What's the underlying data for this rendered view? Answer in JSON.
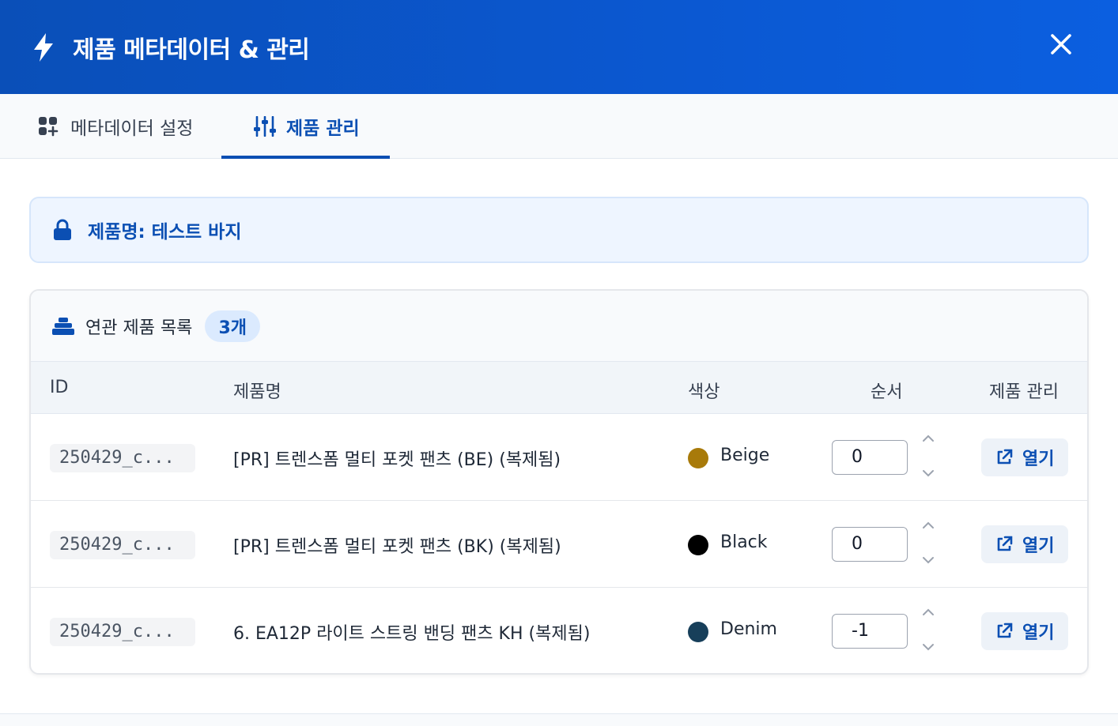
{
  "header": {
    "title": "제품 메타데이터 & 관리",
    "icon": "bolt-icon",
    "close_icon": "close-icon"
  },
  "tabs": [
    {
      "label": "메타데이터 설정",
      "icon": "grid-plus-icon",
      "active": false
    },
    {
      "label": "제품 관리",
      "icon": "sliders-icon",
      "active": true
    }
  ],
  "product_info": {
    "label": "제품명: 테스트 바지",
    "icon": "lock-icon"
  },
  "related": {
    "title": "연관 제품 목록",
    "count": "3개",
    "icon": "stack-icon",
    "columns": [
      "ID",
      "제품명",
      "색상",
      "순서",
      "제품 관리"
    ],
    "rows": [
      {
        "id": "250429_c...",
        "name": "[PR] 트렌스폼 멀티 포켓 팬츠 (BE) (복제됨)",
        "color_name": "Beige",
        "color_hex": "#a87a0a",
        "order": "0",
        "action": "열기"
      },
      {
        "id": "250429_c...",
        "name": "[PR] 트렌스폼 멀티 포켓 팬츠 (BK) (복제됨)",
        "color_name": "Black",
        "color_hex": "#000000",
        "order": "0",
        "action": "열기"
      },
      {
        "id": "250429_c...",
        "name": "6. EA12P 라이트 스트링 밴딩 팬츠 KH (복제됨)",
        "color_name": "Denim",
        "color_hex": "#173f5a",
        "order": "-1",
        "action": "열기"
      }
    ]
  },
  "colors": {
    "header_bg": "#0b57cf",
    "accent": "#0b4fb3",
    "info_bg": "#eef5ff"
  }
}
